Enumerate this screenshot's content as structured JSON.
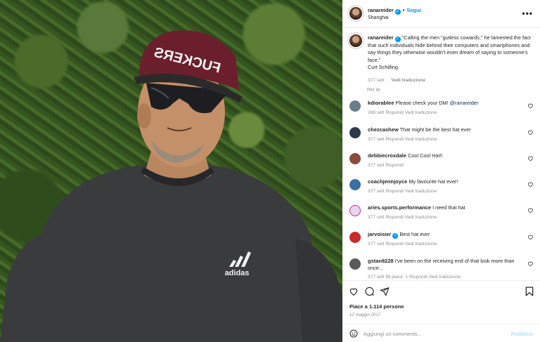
{
  "post": {
    "username": "ranareider",
    "follow_label": "Segui",
    "location": "Shanghai",
    "hat_text": "FUCKERS",
    "shirt_logo_text": "adidas"
  },
  "caption": {
    "username": "ranareider",
    "text": "\"Calling the men \"gutless cowards,\" he lamented the fact that such individuals hide behind their computers and smartphones and say things they otherwise wouldn't even dream of saying to someone's face.\"",
    "signature": "Curt Schilling",
    "time": "377 sett",
    "translate": "Vedi traduzione"
  },
  "per_te_label": "Per te",
  "comments": [
    {
      "username": "kdiorablee",
      "text": "Please check your DM! ",
      "mention": "@ranareider",
      "time": "269 sett",
      "reply": "Rispondi",
      "translate": "Vedi traduzione",
      "avatar_color": "#6b7d8a"
    },
    {
      "username": "chezcashew",
      "text": "That might be the best hat ever",
      "time": "377 sett",
      "reply": "Rispondi",
      "translate": "Vedi traduzione",
      "avatar_color": "#2b3a4a"
    },
    {
      "username": "debbiecroxdale",
      "text": "Cool Cool Hat!!",
      "time": "377 sett",
      "reply": "Rispondi",
      "translate": "",
      "avatar_color": "#8a4b3b"
    },
    {
      "username": "coachjennjoyce",
      "text": "My favourite hat ever!",
      "time": "377 sett",
      "reply": "Rispondi",
      "translate": "Vedi traduzione",
      "avatar_color": "#3b6fa0"
    },
    {
      "username": "aries.sports.performance",
      "text": "I need that hat",
      "time": "377 sett",
      "reply": "Rispondi",
      "translate": "Vedi traduzione",
      "avatar_color": "#e4d7f0"
    },
    {
      "username": "jarvoisier",
      "text": "Best hat ever",
      "time": "377 sett",
      "reply": "Rispondi",
      "translate": "Vedi traduzione",
      "avatar_color": "#c92b2b"
    },
    {
      "username": "gstan8228",
      "text": "I've been on the receiving end of that look more than once...",
      "time": "377 sett",
      "likes": "Mi piace: 1",
      "reply": "Rispondi",
      "translate": "Vedi traduzione",
      "avatar_color": "#5a5a5a"
    }
  ],
  "likes_text": "Piace a 1.114 persone",
  "date": "12 maggio 2017",
  "add_comment_placeholder": "Aggiungi un commento...",
  "publish_label": "Pubblica",
  "colors": {
    "accent": "#0095f6",
    "muted": "#8e8e8e",
    "text": "#262626"
  }
}
